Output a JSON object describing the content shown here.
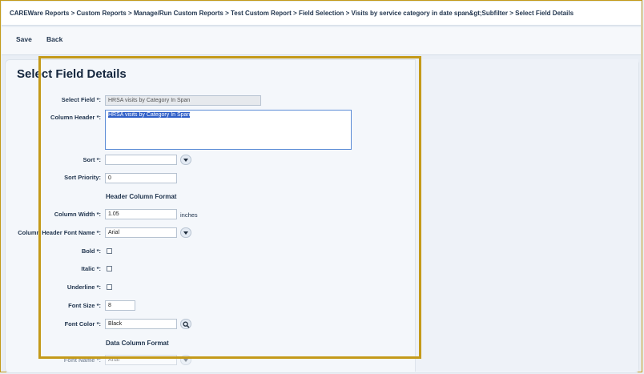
{
  "breadcrumb": "CAREWare Reports > Custom Reports > Manage/Run Custom Reports > Test Custom Report > Field Selection > Visits by service category in date span&gt;Subfilter > Select Field Details",
  "toolbar": {
    "save_label": "Save",
    "back_label": "Back"
  },
  "page": {
    "title": "Select Field Details"
  },
  "form": {
    "select_field_label": "Select Field",
    "select_field_value": "HRSA visits by Category In Span",
    "column_header_label": "Column Header",
    "column_header_value": "HRSA visits by Category In Span",
    "sort_label": "Sort",
    "sort_value": "",
    "sort_priority_label": "Sort Priority:",
    "sort_priority_value": "0",
    "header_section": "Header Column Format",
    "column_width_label": "Column Width",
    "column_width_value": "1.05",
    "column_width_unit": "inches",
    "header_font_label": "Column Header Font Name",
    "header_font_value": "Arial",
    "bold_label": "Bold",
    "italic_label": "Italic",
    "underline_label": "Underline",
    "font_size_label": "Font Size",
    "font_size_value": "8",
    "font_color_label": "Font Color",
    "font_color_value": "Black",
    "data_section": "Data Column Format",
    "data_font_label": "Font Name",
    "data_font_value": "Arial",
    "required_marker": "*:"
  },
  "colors": {
    "highlight": "#c49a1a",
    "accent": "#2f5fc8"
  },
  "icons": {
    "dropdown": "chevron-down-icon",
    "search": "search-icon"
  }
}
